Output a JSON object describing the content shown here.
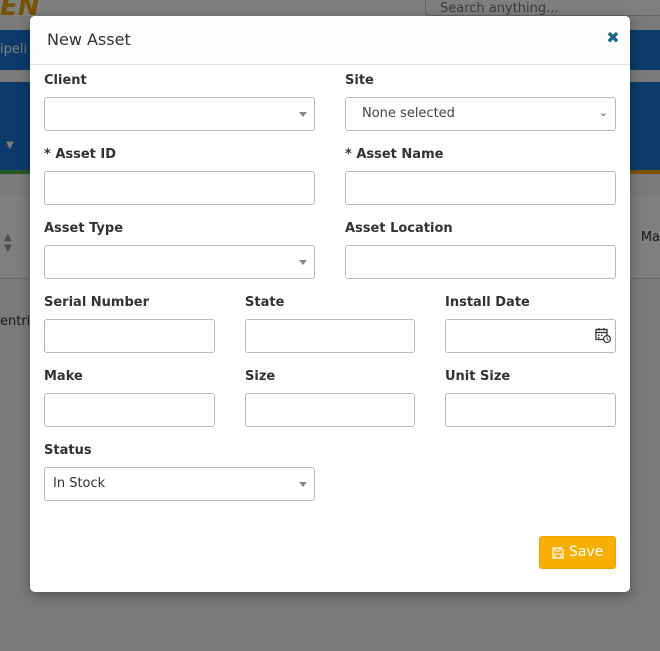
{
  "background": {
    "logo_text": "EN",
    "search_placeholder": "Search anything...",
    "nav_text": "ipeli",
    "column_partial": "Ma",
    "entries_partial": "entri"
  },
  "modal": {
    "title": "New Asset",
    "close_icon": "close-icon",
    "fields": {
      "client": {
        "label": "Client",
        "value": ""
      },
      "site": {
        "label": "Site",
        "value": "None selected"
      },
      "asset_id": {
        "label": "* Asset ID",
        "value": ""
      },
      "asset_name": {
        "label": "* Asset Name",
        "value": ""
      },
      "asset_type": {
        "label": "Asset Type",
        "value": ""
      },
      "asset_location": {
        "label": "Asset Location",
        "value": ""
      },
      "serial_number": {
        "label": "Serial Number",
        "value": ""
      },
      "state": {
        "label": "State",
        "value": ""
      },
      "install_date": {
        "label": "Install Date",
        "value": ""
      },
      "make": {
        "label": "Make",
        "value": ""
      },
      "size": {
        "label": "Size",
        "value": ""
      },
      "unit_size": {
        "label": "Unit Size",
        "value": ""
      },
      "status": {
        "label": "Status",
        "value": "In Stock"
      }
    },
    "save_label": "Save",
    "accent_color": "#f8ae00"
  }
}
